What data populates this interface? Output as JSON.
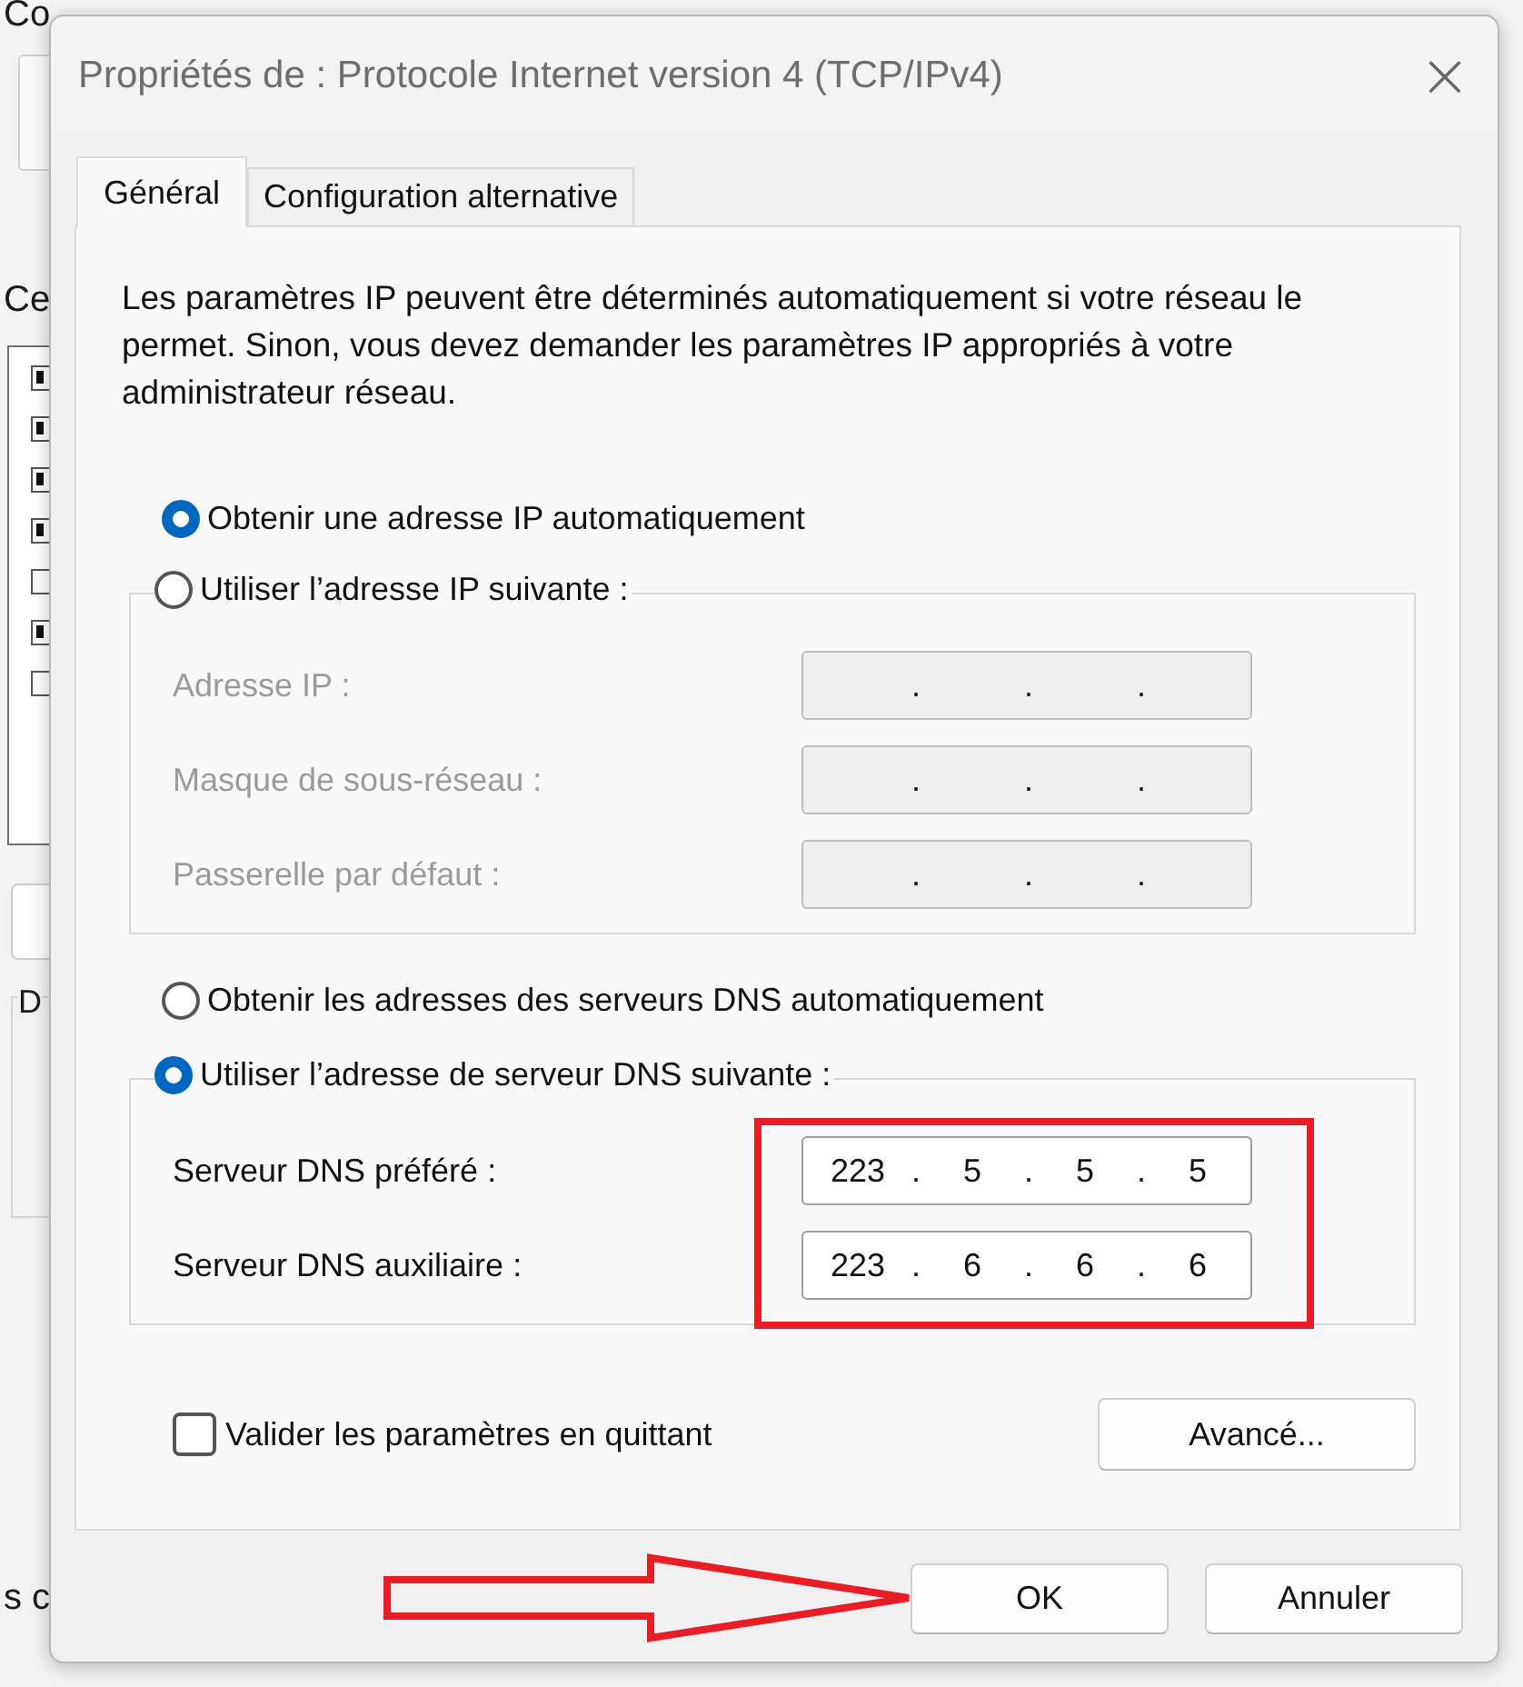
{
  "background_window": {
    "heading_1": "Co",
    "heading_2": "Ce",
    "list_items": [
      {
        "checked": true
      },
      {
        "checked": true
      },
      {
        "checked": true
      },
      {
        "checked": true
      },
      {
        "checked": false
      },
      {
        "checked": true
      },
      {
        "checked": false
      }
    ],
    "group_label": "D",
    "footer_text": "s c"
  },
  "dialog": {
    "title": "Propriétés de : Protocole Internet version 4 (TCP/IPv4)",
    "close": "×",
    "tabs": [
      {
        "label": "Général",
        "selected": true
      },
      {
        "label": "Configuration alternative",
        "selected": false
      }
    ],
    "intro": "Les paramètres IP peuvent être déterminés automatiquement si votre réseau le permet. Sinon, vous devez demander les paramètres IP appropriés à votre administrateur réseau.",
    "ip_options": [
      {
        "label": "Obtenir une adresse IP automatiquement",
        "selected": true
      },
      {
        "label": "Utiliser l’adresse IP suivante :",
        "selected": false
      }
    ],
    "ip_fields": [
      {
        "label": "Adresse IP :",
        "disabled": true,
        "separator": "."
      },
      {
        "label": "Masque de sous-réseau :",
        "disabled": true,
        "separator": "."
      },
      {
        "label": "Passerelle par défaut :",
        "disabled": true,
        "separator": "."
      }
    ],
    "dns_options": [
      {
        "label": "Obtenir les adresses des serveurs DNS automatiquement",
        "selected": false
      },
      {
        "label": "Utiliser l’adresse de serveur DNS suivante :",
        "selected": true
      }
    ],
    "dns_fields": [
      {
        "label": "Serveur DNS préféré :",
        "disabled": false,
        "separator": ".",
        "octets": [
          "223",
          "5",
          "5",
          "5"
        ]
      },
      {
        "label": "Serveur DNS auxiliaire :",
        "disabled": false,
        "separator": ".",
        "octets": [
          "223",
          "6",
          "6",
          "6"
        ]
      }
    ],
    "validate": {
      "label": "Valider les paramètres en quittant",
      "checked": false
    },
    "advanced_button": "Avancé...",
    "buttons": [
      "OK",
      "Annuler"
    ]
  }
}
